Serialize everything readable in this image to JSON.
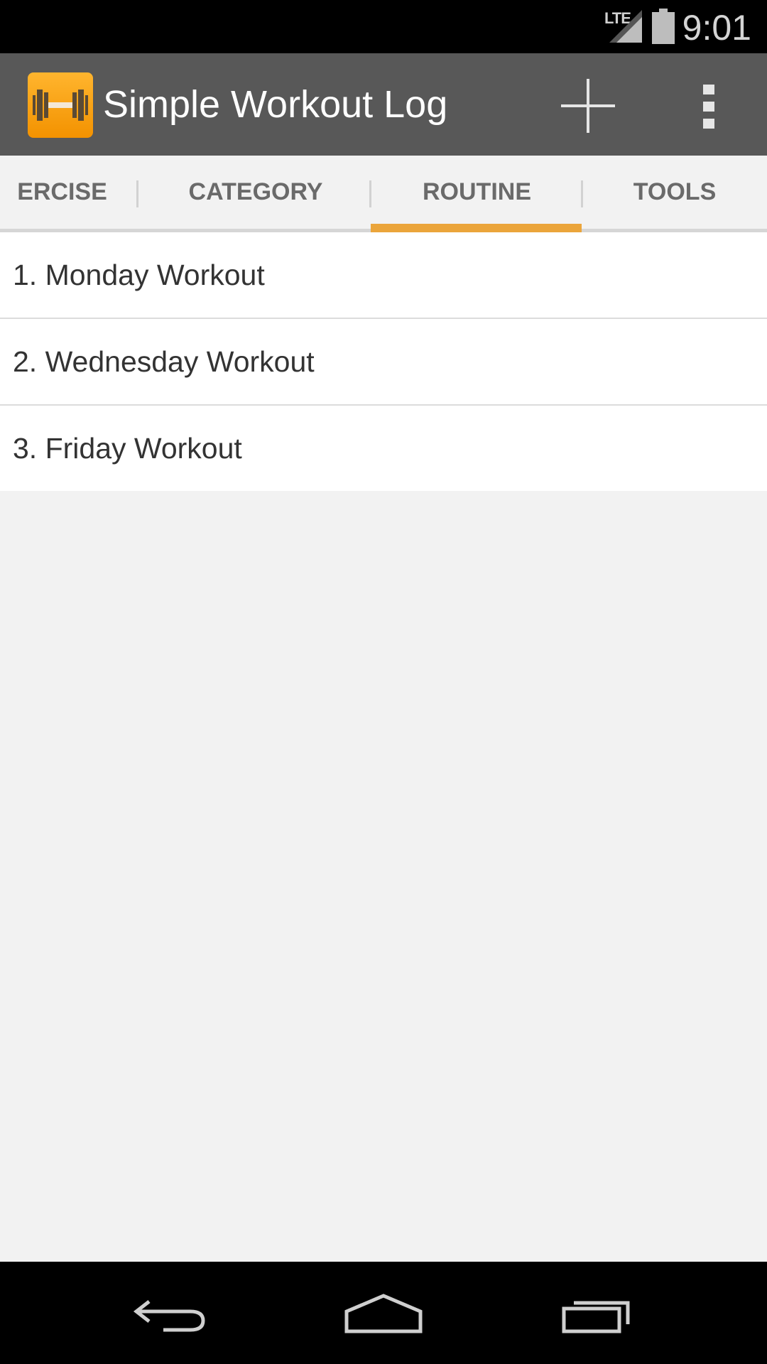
{
  "status_bar": {
    "network": "LTE",
    "time": "9:01"
  },
  "action_bar": {
    "title": "Simple Workout Log",
    "logo_icon": "dumbbell-icon",
    "add_icon": "plus-icon",
    "overflow_icon": "overflow-menu-icon"
  },
  "tabs": [
    {
      "label": "ERCISE",
      "selected": false
    },
    {
      "label": "CATEGORY",
      "selected": false
    },
    {
      "label": "ROUTINE",
      "selected": true
    },
    {
      "label": "TOOLS",
      "selected": false
    }
  ],
  "routines": [
    {
      "label": "1. Monday Workout"
    },
    {
      "label": "2. Wednesday Workout"
    },
    {
      "label": "3. Friday Workout"
    }
  ],
  "nav_bar": {
    "back_icon": "back-icon",
    "home_icon": "home-icon",
    "recents_icon": "recents-icon"
  },
  "colors": {
    "action_bar": "#585858",
    "accent": "#eba53b",
    "logo": "#f39200",
    "background": "#f2f2f2"
  }
}
